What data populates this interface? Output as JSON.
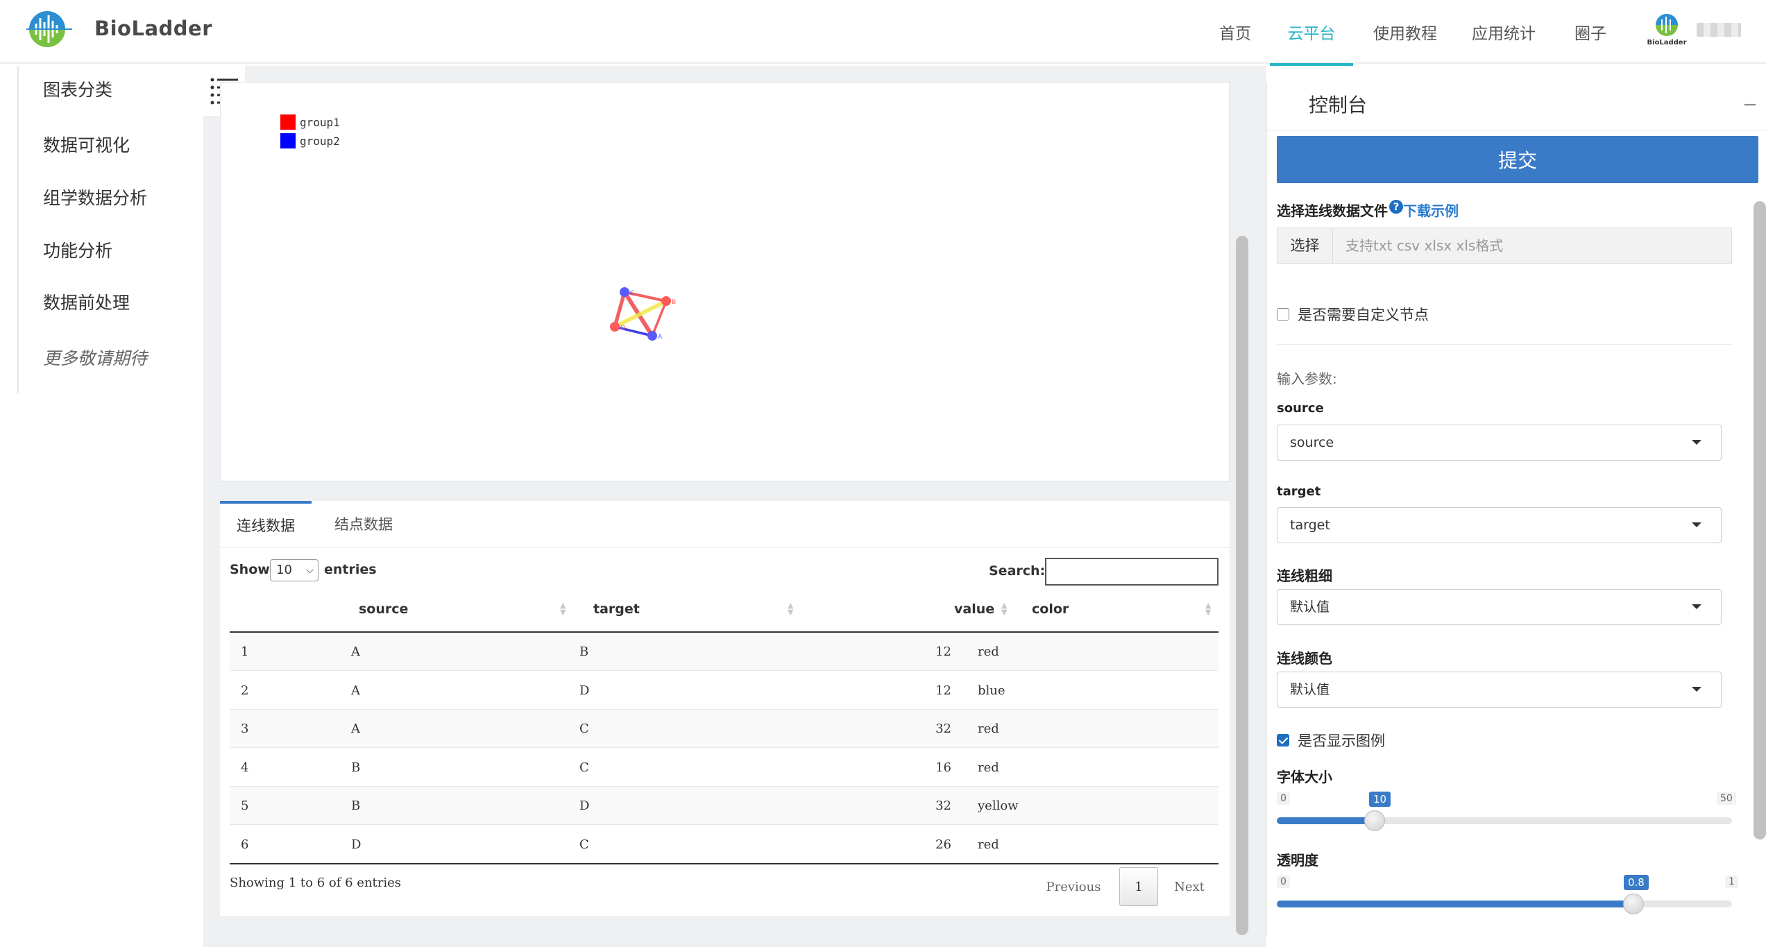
{
  "header": {
    "brand": "BioLadder",
    "nav": [
      {
        "label": "首页"
      },
      {
        "label": "云平台",
        "active": true
      },
      {
        "label": "使用教程"
      },
      {
        "label": "应用统计"
      },
      {
        "label": "圈子"
      }
    ],
    "avatar_text": "BioLadder",
    "accent_color": "#27b6c8"
  },
  "sidebar": {
    "items": [
      {
        "label": "图表分类"
      },
      {
        "label": "数据可视化"
      },
      {
        "label": "组学数据分析"
      },
      {
        "label": "功能分析"
      },
      {
        "label": "数据前处理"
      },
      {
        "label": "更多敬请期待"
      }
    ]
  },
  "chart": {
    "legend": [
      {
        "label": "group1",
        "color": "#ff0000"
      },
      {
        "label": "group2",
        "color": "#0000ff"
      }
    ],
    "nodes": [
      {
        "id": "C",
        "label": "C",
        "group": "group2"
      },
      {
        "id": "B",
        "label": "B",
        "group": "group1"
      },
      {
        "id": "D",
        "label": "D",
        "group": "group1"
      },
      {
        "id": "A",
        "label": "A",
        "group": "group2"
      }
    ],
    "edges": [
      {
        "source": "A",
        "target": "B",
        "value": 12,
        "color": "red"
      },
      {
        "source": "A",
        "target": "D",
        "value": 12,
        "color": "blue"
      },
      {
        "source": "A",
        "target": "C",
        "value": 32,
        "color": "red"
      },
      {
        "source": "B",
        "target": "C",
        "value": 16,
        "color": "red"
      },
      {
        "source": "B",
        "target": "D",
        "value": 32,
        "color": "yellow"
      },
      {
        "source": "D",
        "target": "C",
        "value": 26,
        "color": "red"
      }
    ]
  },
  "table": {
    "tabs": [
      {
        "label": "连线数据",
        "active": true
      },
      {
        "label": "结点数据"
      }
    ],
    "show_label": "Show",
    "page_size": "10",
    "entries_label": "entries",
    "search_label": "Search:",
    "columns": [
      "source",
      "target",
      "value",
      "color"
    ],
    "rows": [
      {
        "n": "1",
        "source": "A",
        "target": "B",
        "value": "12",
        "color": "red"
      },
      {
        "n": "2",
        "source": "A",
        "target": "D",
        "value": "12",
        "color": "blue"
      },
      {
        "n": "3",
        "source": "A",
        "target": "C",
        "value": "32",
        "color": "red"
      },
      {
        "n": "4",
        "source": "B",
        "target": "C",
        "value": "16",
        "color": "red"
      },
      {
        "n": "5",
        "source": "B",
        "target": "D",
        "value": "32",
        "color": "yellow"
      },
      {
        "n": "6",
        "source": "D",
        "target": "C",
        "value": "26",
        "color": "red"
      }
    ],
    "info": "Showing 1 to 6 of 6 entries",
    "previous": "Previous",
    "current_page": "1",
    "next": "Next"
  },
  "console": {
    "title": "控制台",
    "collapse": "−",
    "submit": "提交",
    "file_label": "选择连线数据文件",
    "help": "?",
    "download_example": "下载示例",
    "file_button": "选择",
    "file_placeholder": "支持txt csv xlsx xls格式",
    "custom_nodes_label": "是否需要自定义节点",
    "custom_nodes_checked": false,
    "params_label": "输入参数:",
    "source_label": "source",
    "source_value": "source",
    "target_label": "target",
    "target_value": "target",
    "width_label": "连线粗细",
    "width_value": "默认值",
    "color_label": "连线颜色",
    "color_value": "默认值",
    "show_legend_label": "是否显示图例",
    "show_legend_checked": true,
    "font_size_label": "字体大小",
    "font_size": {
      "min": "0",
      "max": "50",
      "value": "10"
    },
    "opacity_label": "透明度",
    "opacity": {
      "min": "0",
      "max": "1",
      "value": "0.8"
    },
    "primary_color": "#3a7bc8"
  }
}
